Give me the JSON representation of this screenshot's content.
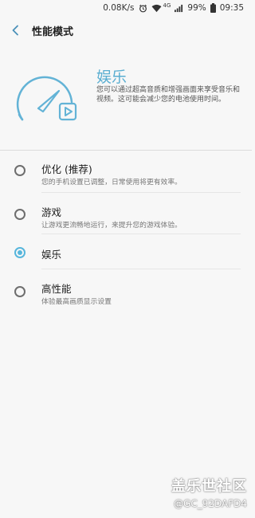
{
  "status_bar": {
    "speed": "0.08K/s",
    "network": "4G",
    "battery": "99%",
    "time": "09:35",
    "icons": [
      "alarm-icon",
      "wifi-icon",
      "signal-icon",
      "battery-icon"
    ]
  },
  "header": {
    "title": "性能模式",
    "back_icon": "chevron-left-icon"
  },
  "hero": {
    "title": "娱乐",
    "description": "您可以通过超高音质和增强画面来享受音乐和视频。这可能会减少您的电池使用时间。",
    "icon": "speedometer-play-icon"
  },
  "options": [
    {
      "label": "优化 (推荐)",
      "sub": "您的手机设置已调整，日常使用将更有效率。",
      "checked": false
    },
    {
      "label": "游戏",
      "sub": "让游戏更流畅地运行，来提升您的游戏体验。",
      "checked": false
    },
    {
      "label": "娱乐",
      "sub": "",
      "checked": true
    },
    {
      "label": "高性能",
      "sub": "体验最高画质显示设置",
      "checked": false
    }
  ],
  "watermark": {
    "logo": "盖乐世社区",
    "user": "@GC_92DAFD4"
  },
  "colors": {
    "accent": "#57b6dc",
    "background": "#f7f7f7"
  }
}
